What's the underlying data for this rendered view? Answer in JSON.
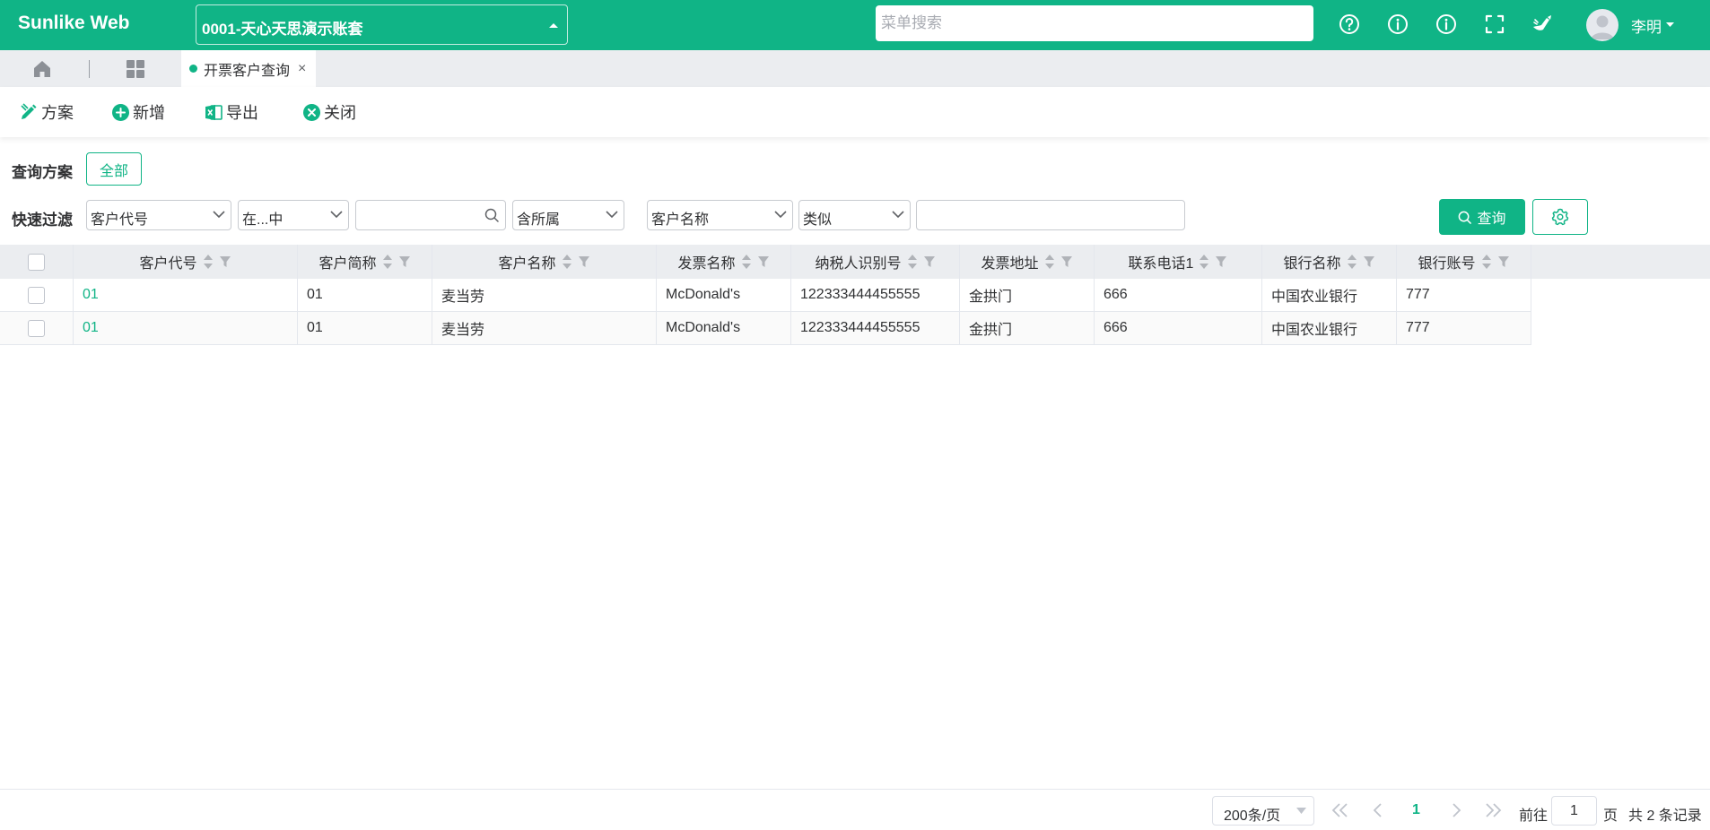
{
  "app": {
    "brand": "Sunlike Web"
  },
  "header": {
    "account": "0001-天心天思演示账套",
    "search_placeholder": "菜单搜索",
    "user_name": "李明"
  },
  "tabs": {
    "active_label": "开票客户查询",
    "close_glyph": "×"
  },
  "toolbar": {
    "scheme": "方案",
    "add": "新增",
    "export": "导出",
    "close": "关闭"
  },
  "query": {
    "scheme_label": "查询方案",
    "scheme_all": "全部",
    "filter_label": "快速过滤",
    "filter1_field": "客户代号",
    "filter1_op": "在...中",
    "filter1_value": "",
    "filter1_scope": "含所属",
    "filter2_field": "客户名称",
    "filter2_op": "类似",
    "filter2_value": "",
    "query_button": "查询"
  },
  "table": {
    "columns": [
      "客户代号",
      "客户简称",
      "客户名称",
      "发票名称",
      "纳税人识别号",
      "发票地址",
      "联系电话1",
      "银行名称",
      "银行账号"
    ],
    "rows": [
      [
        "01",
        "01",
        "麦当劳",
        "McDonald's",
        "122333444455555",
        "金拱门",
        "666",
        "中国农业银行",
        "777"
      ],
      [
        "01",
        "01",
        "麦当劳",
        "McDonald's",
        "122333444455555",
        "金拱门",
        "666",
        "中国农业银行",
        "777"
      ]
    ]
  },
  "pagination": {
    "page_size": "200条/页",
    "current_page": "1",
    "goto_label": "前往",
    "goto_value": "1",
    "page_unit": "页",
    "total": "共 2 条记录"
  },
  "colors": {
    "brand": "#10b486",
    "header_bg": "#ebedf0"
  },
  "icons": [
    "help-icon",
    "info-icon",
    "info-icon",
    "fullscreen-icon",
    "theme-icon",
    "home-icon",
    "grid-icon",
    "sort-icon",
    "filter-icon",
    "search-icon",
    "settings-icon"
  ]
}
